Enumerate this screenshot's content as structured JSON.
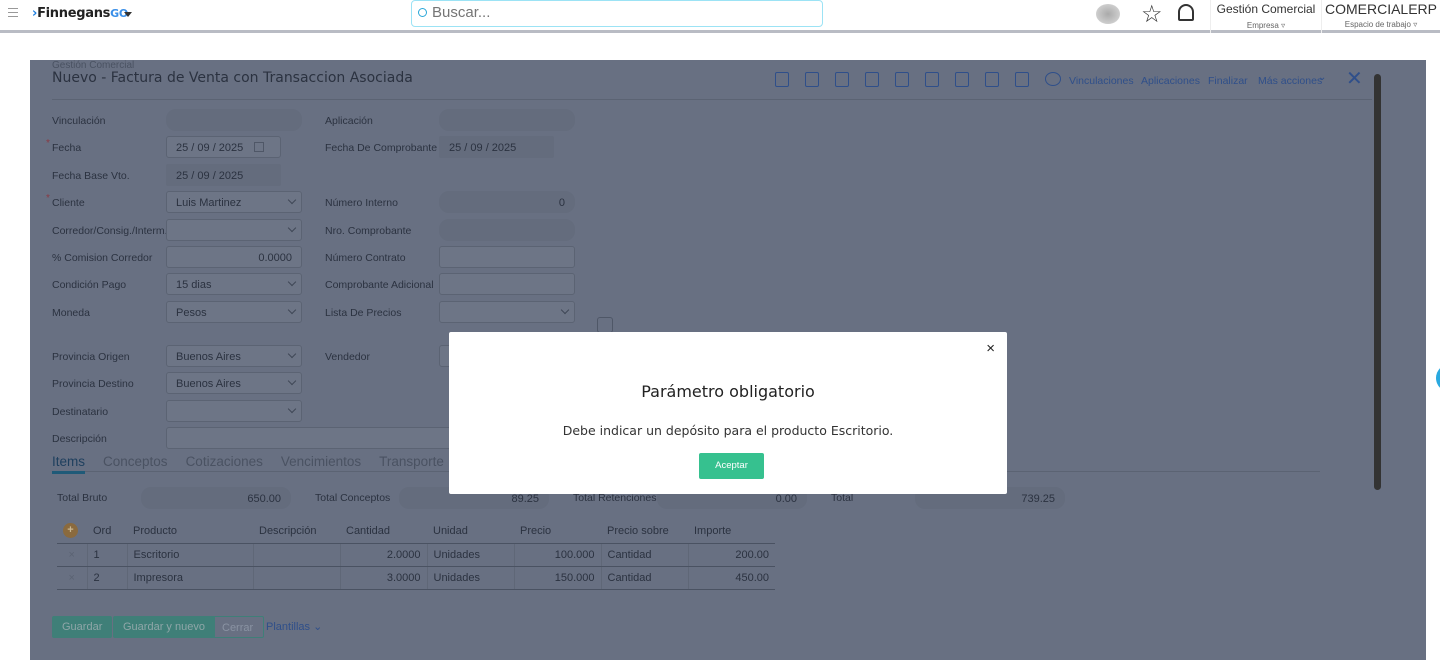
{
  "header": {
    "brand": "Finnegans",
    "brand_suffix": "GO",
    "search_placeholder": "Buscar...",
    "company": "Gestión Comercial",
    "company_sub": "Empresa",
    "workspace": "COMERCIALERP",
    "workspace_sub": "Espacio de trabajo"
  },
  "form": {
    "breadcrumb": "Gestión Comercial",
    "title": "Nuevo - Factura de Venta con Transaccion Asociada",
    "toolbar": [
      "Vinculaciones",
      "Aplicaciones",
      "Finalizar",
      "Más acciones"
    ],
    "left": [
      {
        "label": "Vinculación",
        "value": "",
        "kind": "ro"
      },
      {
        "label": "Fecha",
        "value": "25 / 09 / 2025",
        "kind": "date",
        "required": true
      },
      {
        "label": "Fecha Base Vto.",
        "value": "25 / 09 / 2025",
        "kind": "dro"
      },
      {
        "label": "Cliente",
        "value": "Luis Martinez",
        "kind": "sel",
        "required": true
      },
      {
        "label": "Corredor/Consig./Interm.",
        "value": "",
        "kind": "sel"
      },
      {
        "label": "% Comision Corredor",
        "value": "0.0000",
        "kind": "num"
      },
      {
        "label": "Condición Pago",
        "value": "15 dias",
        "kind": "sel"
      },
      {
        "label": "Moneda",
        "value": "Pesos",
        "kind": "sel"
      },
      {
        "label": "Provincia Origen",
        "value": "Buenos Aires",
        "kind": "sel"
      },
      {
        "label": "Provincia Destino",
        "value": "Buenos Aires",
        "kind": "sel"
      },
      {
        "label": "Destinatario",
        "value": "",
        "kind": "sel"
      },
      {
        "label": "Descripción",
        "value": "",
        "kind": "wide"
      }
    ],
    "right": [
      {
        "label": "Aplicación",
        "value": "",
        "kind": "ro",
        "row": 0
      },
      {
        "label": "Fecha De Comprobante",
        "value": "25 / 09 / 2025",
        "kind": "dro",
        "row": 1
      },
      {
        "label": "Número Interno",
        "value": "0",
        "kind": "ronum",
        "row": 3
      },
      {
        "label": "Nro. Comprobante",
        "value": "",
        "kind": "ro",
        "row": 4
      },
      {
        "label": "Número Contrato",
        "value": "",
        "kind": "txt",
        "row": 5
      },
      {
        "label": "Comprobante Adicional",
        "value": "",
        "kind": "txt",
        "row": 6
      },
      {
        "label": "Lista De Precios",
        "value": "",
        "kind": "sel",
        "row": 7
      },
      {
        "label": "Vendedor",
        "value": "",
        "kind": "txt",
        "row": 8
      }
    ],
    "tabs": [
      "Items",
      "Conceptos",
      "Cotizaciones",
      "Vencimientos",
      "Transporte"
    ],
    "totals": [
      {
        "label": "Total Bruto",
        "value": "650.00"
      },
      {
        "label": "Total Conceptos",
        "value": "89.25"
      },
      {
        "label": "Total Retenciones",
        "value": "0.00"
      },
      {
        "label": "Total",
        "value": "739.25"
      }
    ],
    "items": {
      "columns": [
        "Ord",
        "Producto",
        "Descripción",
        "Cantidad",
        "Unidad",
        "Precio",
        "Precio sobre",
        "Importe"
      ],
      "rows": [
        [
          "1",
          "Escritorio",
          "",
          "2.0000",
          "Unidades",
          "100.000",
          "Cantidad",
          "200.00"
        ],
        [
          "2",
          "Impresora",
          "",
          "3.0000",
          "Unidades",
          "150.000",
          "Cantidad",
          "450.00"
        ]
      ]
    },
    "buttons": {
      "save": "Guardar",
      "save_new": "Guardar y nuevo",
      "close": "Cerrar",
      "templates": "Plantillas"
    }
  },
  "modal": {
    "title": "Parámetro obligatorio",
    "message": "Debe indicar un depósito para el producto Escritorio.",
    "accept": "Aceptar",
    "close": "×"
  }
}
